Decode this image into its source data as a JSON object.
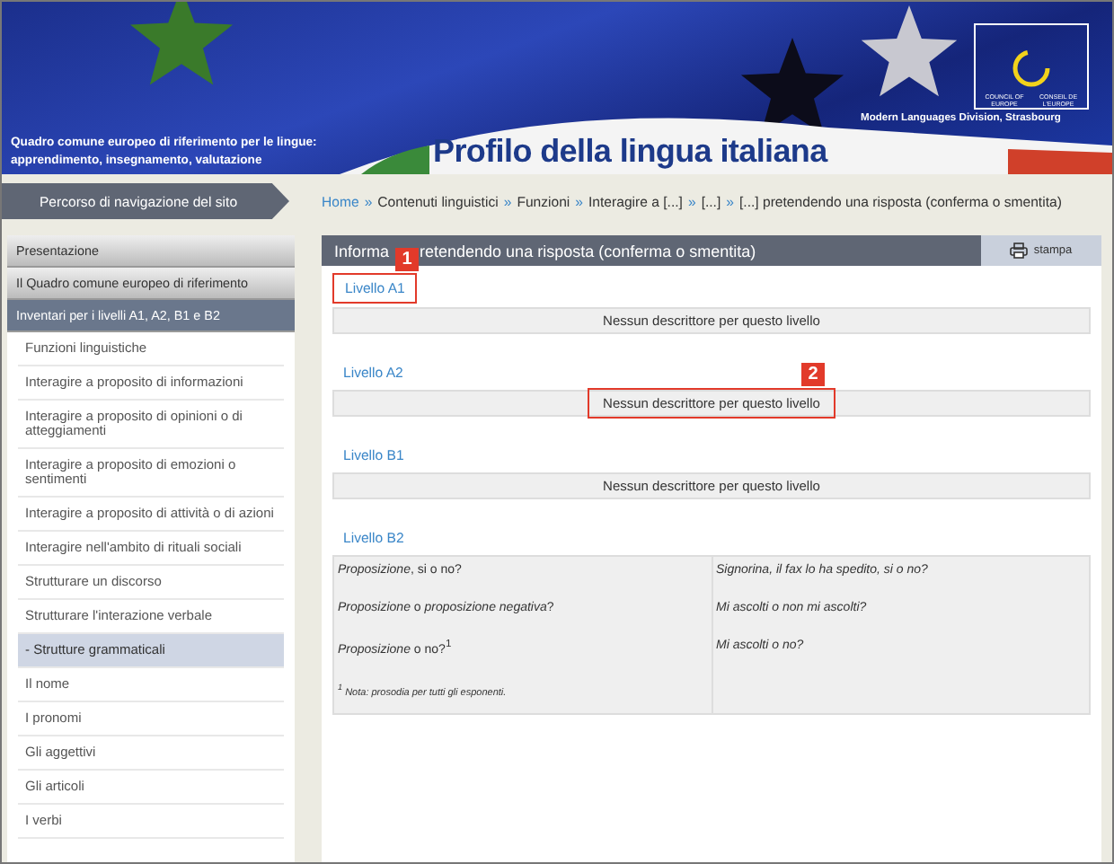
{
  "banner": {
    "subtitle_lines": [
      "Quadro comune europeo di riferimento per le lingue:",
      "apprendimento, insegnamento, valutazione"
    ],
    "title": "Profilo della lingua italiana",
    "logo_lines": [
      "COUNCIL OF EUROPE",
      "CONSEIL DE L'EUROPE"
    ],
    "division": "Modern Languages Division, Strasbourg"
  },
  "nav_label": "Percorso di navigazione del sito",
  "breadcrumb_separator": "»",
  "breadcrumb": [
    {
      "label": "Home",
      "kind": "link"
    },
    {
      "label": "Contenuti linguistici",
      "kind": "text"
    },
    {
      "label": "Funzioni",
      "kind": "text"
    },
    {
      "label": "Interagire a [...]",
      "kind": "text"
    },
    {
      "label": "[...]",
      "kind": "text"
    },
    {
      "label": "[...] pretendendo una risposta (conferma o smentita)",
      "kind": "text"
    }
  ],
  "sidebar": {
    "items": [
      {
        "label": "Presentazione",
        "kind": "header",
        "selected": false
      },
      {
        "label": "Il Quadro comune europeo di riferimento",
        "kind": "header",
        "selected": false
      },
      {
        "label": "Inventari per i livelli A1, A2, B1 e B2",
        "kind": "header",
        "selected": true
      },
      {
        "label": "Funzioni linguistiche",
        "kind": "item",
        "selected": false
      },
      {
        "label": "Interagire a proposito di informazioni",
        "kind": "item",
        "selected": false
      },
      {
        "label": "Interagire a proposito di opinioni o di atteggiamenti",
        "kind": "item",
        "selected": false
      },
      {
        "label": "Interagire a proposito di emozioni o sentimenti",
        "kind": "item",
        "selected": false
      },
      {
        "label": "Interagire a proposito di attività o di azioni",
        "kind": "item",
        "selected": false
      },
      {
        "label": "Interagire nell'ambito di rituali sociali",
        "kind": "item",
        "selected": false
      },
      {
        "label": "Strutturare un discorso",
        "kind": "item",
        "selected": false
      },
      {
        "label": "Strutturare l'interazione verbale",
        "kind": "item",
        "selected": false
      },
      {
        "label": "- Strutture grammaticali",
        "kind": "item",
        "selected": true
      },
      {
        "label": "Il nome",
        "kind": "item",
        "selected": false
      },
      {
        "label": "I pronomi",
        "kind": "item",
        "selected": false
      },
      {
        "label": "Gli aggettivi",
        "kind": "item",
        "selected": false
      },
      {
        "label": "Gli articoli",
        "kind": "item",
        "selected": false
      },
      {
        "label": "I verbi",
        "kind": "item",
        "selected": false
      }
    ]
  },
  "content": {
    "title_parts": [
      "Informa",
      "retendendo una risposta (conferma o smentita)"
    ],
    "print_button": "stampa",
    "levels": [
      {
        "heading": "Livello A1",
        "kind": "empty",
        "message": "Nessun descrittore per questo livello"
      },
      {
        "heading": "Livello A2",
        "kind": "empty",
        "message": "Nessun descrittore per questo livello"
      },
      {
        "heading": "Livello B1",
        "kind": "empty",
        "message": "Nessun descrittore per questo livello"
      },
      {
        "heading": "Livello B2",
        "kind": "table",
        "columns": [
          [
            "*Proposizione*, si o no?",
            "*Proposizione* o *proposizione negativa*?",
            "*Proposizione* o no?$^{1}$"
          ],
          [
            "Signorina, il fax lo ha spedito, si o no?",
            "Mi ascolti o non mi ascolti?",
            "Mi ascolti o no?"
          ]
        ],
        "note": "$^{1}$ Nota: prosodia per tutti gli esponenti."
      }
    ]
  },
  "callouts": [
    "1",
    "2"
  ]
}
